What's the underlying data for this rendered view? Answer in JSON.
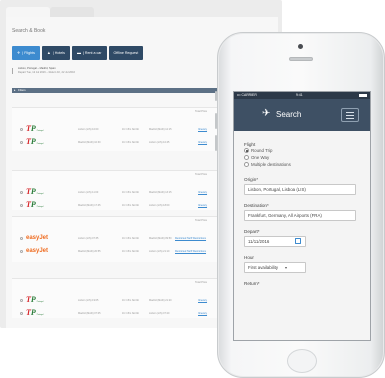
{
  "desktop": {
    "page_title": "Search & Book",
    "nav": [
      {
        "icon": "✈",
        "label": "| Flights"
      },
      {
        "icon": "▲",
        "label": "| Hotels"
      },
      {
        "icon": "▬",
        "label": "| Rent a car"
      },
      {
        "icon": "",
        "label": "Offline Request"
      }
    ],
    "search_summary": {
      "route": "Lisbon, Portugal – Madrid, Spain",
      "dates": "Depart Tue, 12 Jul 2016  –  Return Fri, 22 Jul 2016"
    },
    "filter_label": "Filters",
    "fare_header": "Total Price",
    "results": [
      {
        "rows": [
          {
            "airline": "tap",
            "depart": "Lisbon (LIS) 10:00",
            "duration": "1hr 15m NonSt",
            "arrive": "Madrid (MAD) 12:15",
            "link": "Itinerary"
          },
          {
            "airline": "tap",
            "depart": "Madrid (MAD) 10:30",
            "duration": "1hr 15m NonSt",
            "arrive": "Lisbon (LIS) 10:45",
            "link": "Itinerary"
          }
        ]
      },
      {
        "rows": [
          {
            "airline": "tap",
            "depart": "Lisbon (LIS) 11:00",
            "duration": "1hr 15m NonSt",
            "arrive": "Madrid (MAD) 13:15",
            "link": "Itinerary"
          },
          {
            "airline": "tap",
            "depart": "Madrid (MAD) 17:45",
            "duration": "1hr 15m NonSt",
            "arrive": "Lisbon (LIS) 18:00",
            "link": "Itinerary"
          }
        ]
      },
      {
        "rows": [
          {
            "airline": "easyjet",
            "depart": "Lisbon (LIS) 07:35",
            "duration": "1hr 15m NonSt",
            "arrive": "Madrid (MAD) 09:50",
            "link": "Restricted Tariff Restrictions"
          },
          {
            "airline": "easyjet",
            "depart": "Madrid (MAD) 20:55",
            "duration": "1hr 15m NonSt",
            "arrive": "Lisbon (LIS) 21:10",
            "link": "Restricted Tariff Restrictions"
          }
        ]
      },
      {
        "rows": [
          {
            "airline": "tap",
            "depart": "Lisbon (LIS) 19:05",
            "duration": "1hr 15m NonSt",
            "arrive": "Madrid (MAD) 21:20",
            "link": "Itinerary"
          },
          {
            "airline": "tap",
            "depart": "Madrid (MAD) 07:05",
            "duration": "1hr 15m NonSt",
            "arrive": "Lisbon (LIS) 07:20",
            "link": "Itinerary"
          }
        ]
      }
    ],
    "logos": {
      "tap_t": "T",
      "tap_p": "P",
      "tap_sub": "Portugal",
      "easyjet": "easyJet"
    },
    "top_right_button": "Lo"
  },
  "phone": {
    "status": {
      "carrier": "••• CARRIER",
      "time": "9:41"
    },
    "header_title": "Search",
    "plane_icon": "✈",
    "form": {
      "flight_label": "Flight",
      "trip_options": [
        "Round Trip",
        "One Way",
        "Multiple destinations"
      ],
      "selected_trip": "Round Trip",
      "origin_label": "Origin*",
      "origin_value": "Lisbon, Portugal, Lisboa (LIS)",
      "destination_label": "Destination*",
      "destination_value": "Frankfurt, Germany, All Airports (FRA)",
      "depart_label": "Depart*",
      "depart_value": "11/11/2016",
      "hour_label": "Hour",
      "hour_value": "First availability",
      "return_label": "Return*"
    }
  },
  "colors": {
    "nav_dark": "#2f4a66",
    "nav_active": "#3d8bcf",
    "phone_header": "#3e5064",
    "tap_red": "#d6262b",
    "tap_green": "#2b7d3a",
    "easyjet_orange": "#ef6b1f"
  }
}
